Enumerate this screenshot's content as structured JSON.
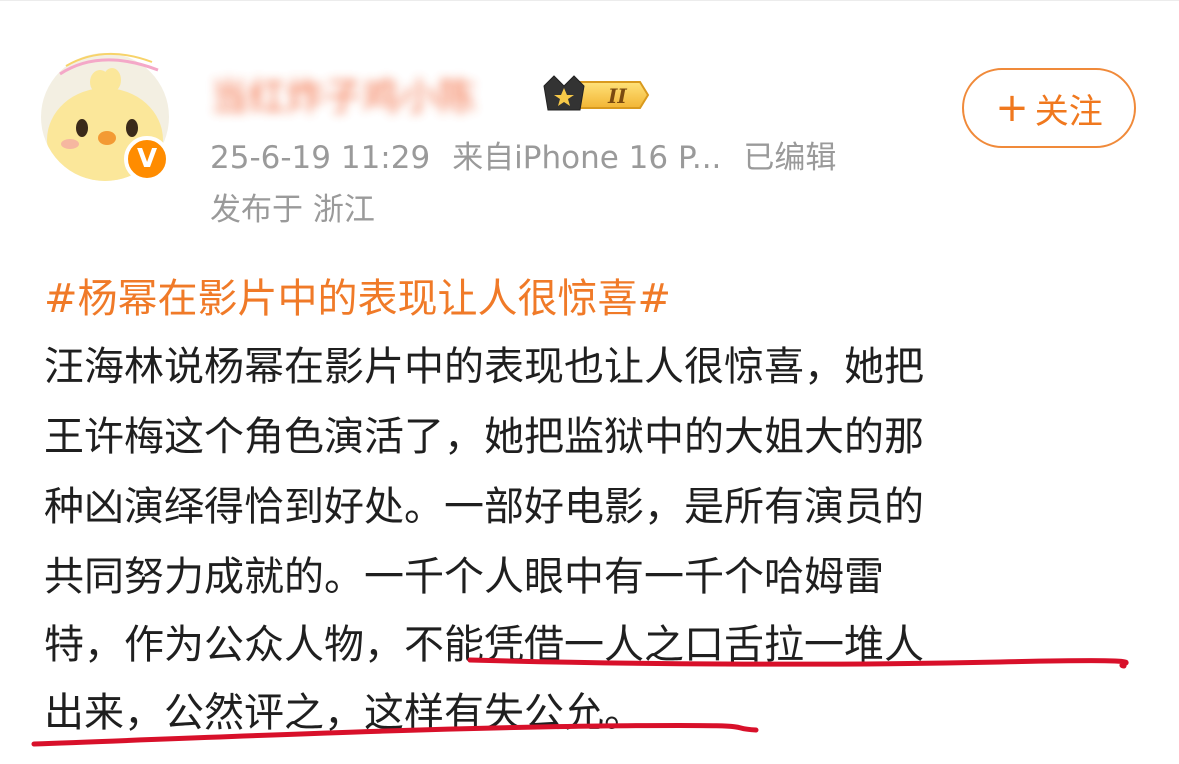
{
  "header": {
    "username": "当红炸子鸡小陈",
    "timestamp": "25-6-19 11:29",
    "source": "来自iPhone 16 P...",
    "edited": "已编辑",
    "location": "发布于 浙江",
    "level_badge": "II",
    "verified_badge": "V",
    "follow_label": "关注",
    "follow_plus": "+"
  },
  "post": {
    "hashtag": "#杨幂在影片中的表现让人很惊喜#",
    "lines": [
      "汪海林说杨幂在影片中的表现也让人很惊喜，她把",
      "王许梅这个角色演活了，她把监狱中的大姐大的那",
      "种凶演绎得恰到好处。一部好电影，是所有演员的",
      "共同努力成就的。一千个人眼中有一千个哈姆雷",
      "特，作为公众人物，不能凭借一人之口舌拉一堆人",
      "出来，公然评之，这样有失公允。"
    ]
  },
  "colors": {
    "accent_orange": "#f07a28",
    "meta_gray": "#9a9a9a",
    "text": "#1f1f1f",
    "underline_red": "#d8102a"
  }
}
